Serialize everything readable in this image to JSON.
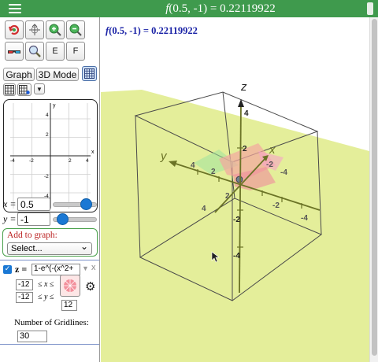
{
  "header": {
    "func_name": "f",
    "title_rest": "(0.5, -1) = 0.22119922"
  },
  "toolbar": {
    "e_label": "E",
    "f_label": "F"
  },
  "tabs": {
    "graph": "Graph",
    "mode3d": "3D Mode"
  },
  "mini_graph": {
    "x_ticks": [
      "-4",
      "-2",
      "2",
      "4"
    ],
    "y_ticks": [
      "4",
      "2",
      "-2",
      "-4"
    ],
    "x_axis": "x",
    "y_axis": "y"
  },
  "vars": {
    "x_label": "x =",
    "x_value": "0.5",
    "x_slider_level": 0.82,
    "y_label": "y =",
    "y_value": "-1",
    "y_slider_level": 0.1
  },
  "add_to_graph": {
    "label": "Add to graph:",
    "select_value": "Select..."
  },
  "function": {
    "lhs": "z =",
    "expression": "1-e^(-(x^2+",
    "x_min": "-12",
    "x_range_text": "≤ x ≤",
    "y_min": "-12",
    "y_range_text": "≤ y ≤",
    "y_max": "12",
    "gridlines_label": "Number of Gridlines:",
    "gridlines_value": "30",
    "remove": "x"
  },
  "stage": {
    "status_func": "f",
    "status_rest": "(0.5, -1) = 0.22119922",
    "axis_labels": {
      "z": "z",
      "y": "y",
      "x": "x"
    },
    "z_ticks": [
      "4",
      "2",
      "-2",
      "-4"
    ],
    "y_ticks": [
      "4",
      "2",
      "-2",
      "-4"
    ],
    "x_ticks": [
      "-2",
      "-4",
      "2",
      "4"
    ]
  },
  "colors": {
    "header_green": "#3f9a4d",
    "plane_yellow": "#e4ee9a",
    "axis_olive": "#6b7326",
    "status_blue": "#1a22a6",
    "slider_blue": "#1a78d4"
  }
}
